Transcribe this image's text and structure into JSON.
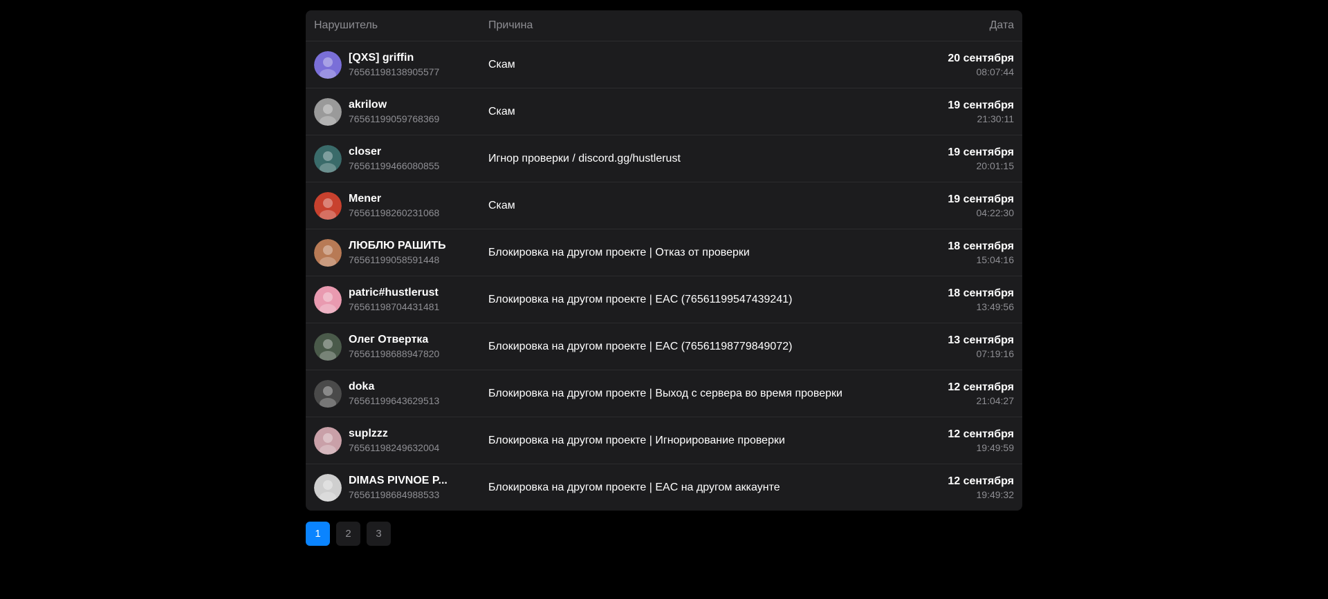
{
  "header": {
    "col_user": "Нарушитель",
    "col_reason": "Причина",
    "col_date": "Дата"
  },
  "rows": [
    {
      "name": "[QXS] griffin",
      "id": "76561198138905577",
      "reason": "Скам",
      "date": "20 сентября",
      "time": "08:07:44",
      "avatar_color": "#7a6fd8"
    },
    {
      "name": "akrilow",
      "id": "76561199059768369",
      "reason": "Скам",
      "date": "19 сентября",
      "time": "21:30:11",
      "avatar_color": "#9a9a9a"
    },
    {
      "name": "closer",
      "id": "76561199466080855",
      "reason": "Игнор проверки / discord.gg/hustlerust",
      "date": "19 сентября",
      "time": "20:01:15",
      "avatar_color": "#3a6b6a"
    },
    {
      "name": "Mener",
      "id": "76561198260231068",
      "reason": "Скам",
      "date": "19 сентября",
      "time": "04:22:30",
      "avatar_color": "#c8412e"
    },
    {
      "name": "ЛЮБЛЮ РАШИТЬ",
      "id": "76561199058591448",
      "reason": "Блокировка на другом проекте | Отказ от проверки",
      "date": "18 сентября",
      "time": "15:04:16",
      "avatar_color": "#b87a55"
    },
    {
      "name": "patric#hustlerust",
      "id": "76561198704431481",
      "reason": "Блокировка на другом проекте | EAC (76561199547439241)",
      "date": "18 сентября",
      "time": "13:49:56",
      "avatar_color": "#e99ab0"
    },
    {
      "name": "Олег Отвертка",
      "id": "76561198688947820",
      "reason": "Блокировка на другом проекте | EAC (76561198779849072)",
      "date": "13 сентября",
      "time": "07:19:16",
      "avatar_color": "#4a5a4a"
    },
    {
      "name": "doka",
      "id": "76561199643629513",
      "reason": "Блокировка на другом проекте | Выход с сервера во время проверки",
      "date": "12 сентября",
      "time": "21:04:27",
      "avatar_color": "#4a4a4a"
    },
    {
      "name": "suplzzz",
      "id": "76561198249632004",
      "reason": "Блокировка на другом проекте | Игнорирование проверки",
      "date": "12 сентября",
      "time": "19:49:59",
      "avatar_color": "#c9a0a8"
    },
    {
      "name": "DIMAS PIVNOE P...",
      "id": "76561198684988533",
      "reason": "Блокировка на другом проекте | EAC на другом аккаунте",
      "date": "12 сентября",
      "time": "19:49:32",
      "avatar_color": "#cfcfcf"
    }
  ],
  "pagination": {
    "pages": [
      "1",
      "2",
      "3"
    ],
    "active": "1"
  },
  "colors": {
    "accent": "#0a84ff",
    "panel": "#1c1c1e",
    "muted": "#8e8e93"
  }
}
